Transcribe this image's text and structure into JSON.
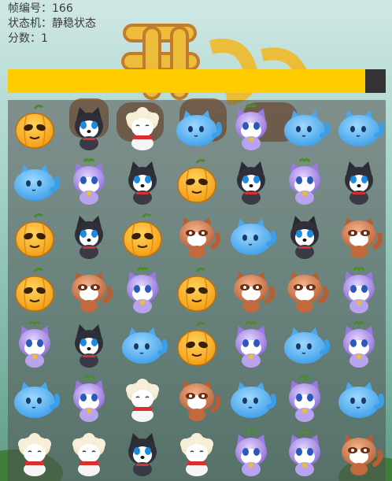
{
  "hud": {
    "frame_label": "帧编号：",
    "frame_value": "166",
    "state_label": "状态机：",
    "state_value": "静稳状态",
    "score_label": "分数：",
    "score_value": "1"
  },
  "progress": {
    "fraction": 0.945
  },
  "colors": {
    "progress_fill": "#ffcc00",
    "progress_track": "#333333",
    "board_overlay": "#505050"
  },
  "board": {
    "rows": 7,
    "cols": 7,
    "tiles": [
      [
        "pumpkin",
        "husky",
        "sheep",
        "blue-cat",
        "purple-cat",
        "blue-cat",
        "blue-cat"
      ],
      [
        "blue-cat",
        "purple-cat",
        "husky",
        "pumpkin",
        "husky",
        "purple-cat",
        "husky"
      ],
      [
        "pumpkin",
        "husky",
        "pumpkin",
        "raccoon",
        "blue-cat",
        "husky",
        "raccoon"
      ],
      [
        "pumpkin",
        "raccoon",
        "purple-cat",
        "pumpkin",
        "raccoon",
        "raccoon",
        "purple-cat"
      ],
      [
        "purple-cat",
        "husky",
        "blue-cat",
        "pumpkin",
        "purple-cat",
        "blue-cat",
        "purple-cat"
      ],
      [
        "blue-cat",
        "purple-cat",
        "sheep",
        "raccoon",
        "blue-cat",
        "purple-cat",
        "blue-cat"
      ],
      [
        "sheep",
        "sheep",
        "husky",
        "sheep",
        "purple-cat",
        "purple-cat",
        "raccoon"
      ]
    ]
  }
}
